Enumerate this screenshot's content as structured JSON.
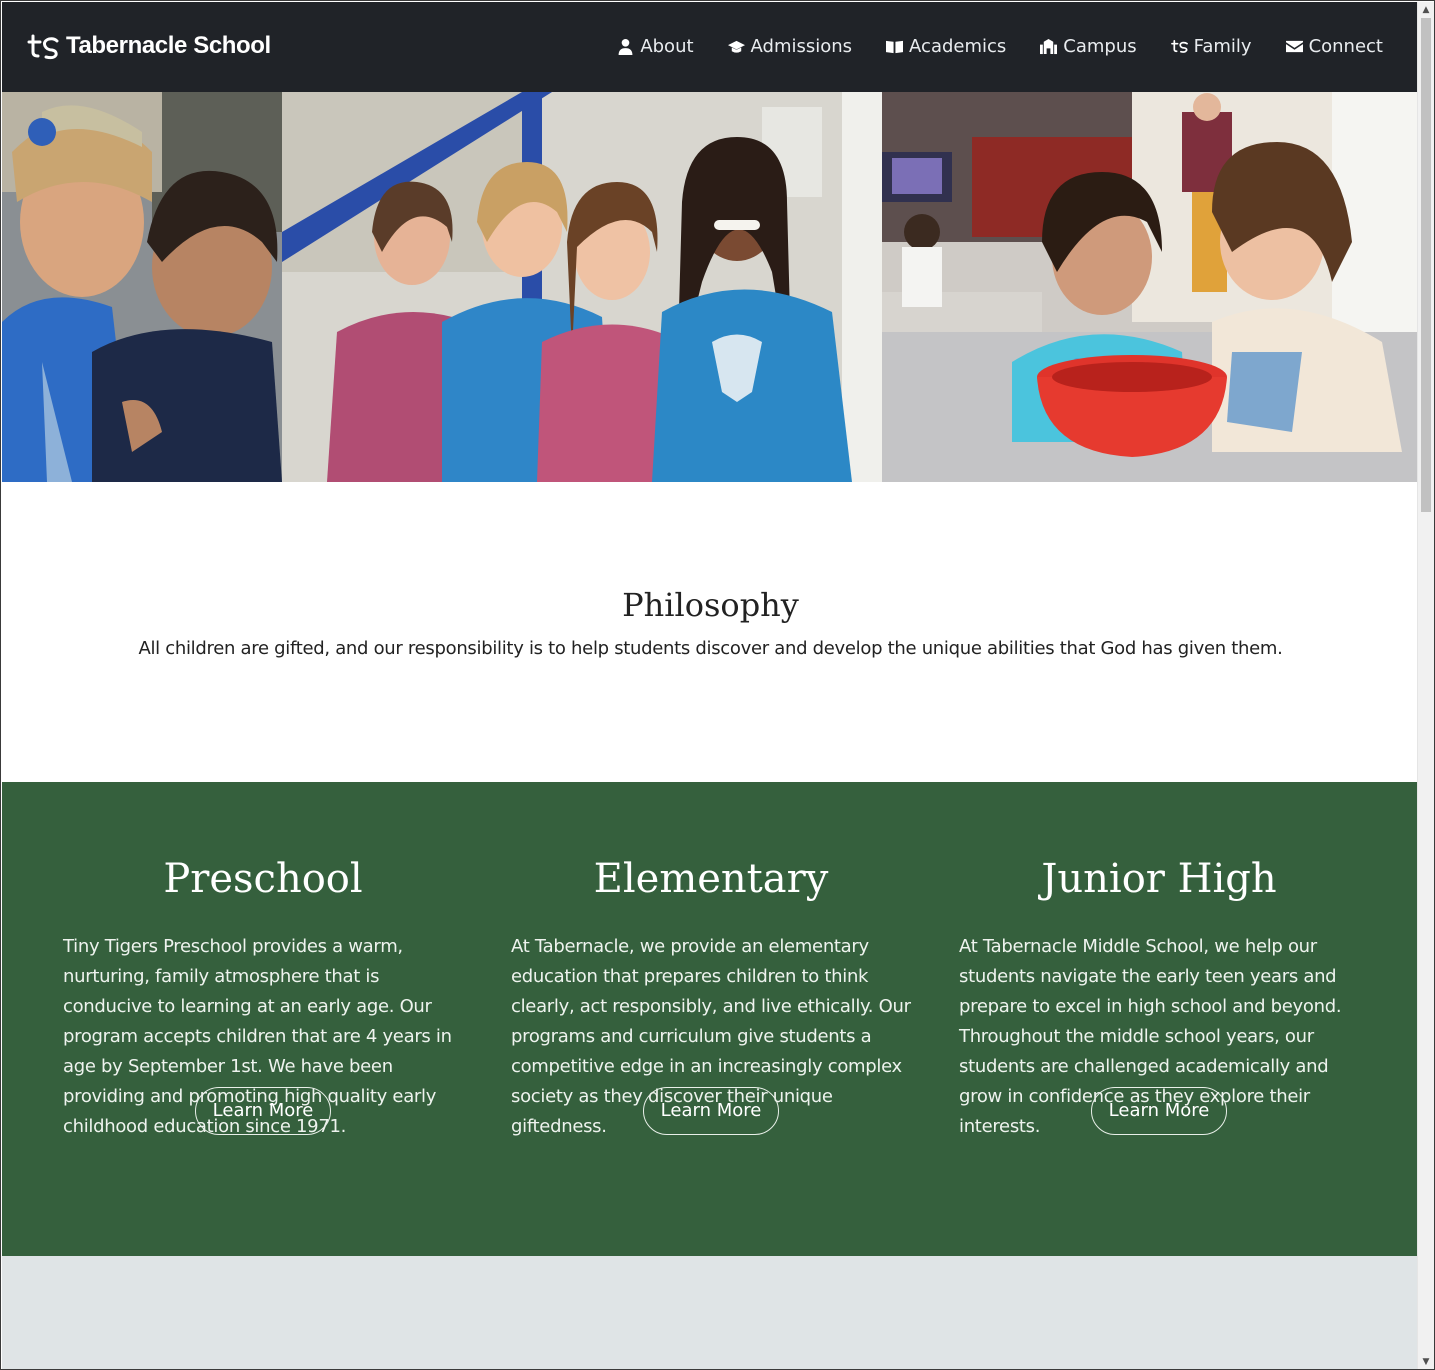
{
  "site": {
    "brand": "Tabernacle School"
  },
  "nav": {
    "items": [
      {
        "label": "About",
        "icon": "person-icon"
      },
      {
        "label": "Admissions",
        "icon": "graduation-cap-icon"
      },
      {
        "label": "Academics",
        "icon": "book-icon"
      },
      {
        "label": "Campus",
        "icon": "building-icon"
      },
      {
        "label": "Family",
        "icon": "ts-logo-icon"
      },
      {
        "label": "Connect",
        "icon": "envelope-icon"
      }
    ]
  },
  "hero": {
    "photos": [
      "students-photo-1",
      "students-photo-2",
      "preschool-photo-3"
    ]
  },
  "philosophy": {
    "title": "Philosophy",
    "text": "All children are gifted, and our responsibility is to help students discover and develop the unique abilities that God has given them."
  },
  "programs": [
    {
      "title": "Preschool",
      "text": "Tiny Tigers  Preschool provides a warm, nurturing, family atmosphere that is conducive to learning at an early age. Our program accepts children that are 4 years in age by September 1st. We have been providing and promoting high quality early childhood education since 1971.",
      "button": "Learn  More"
    },
    {
      "title": "Elementary",
      "text": "At Tabernacle, we provide an elementary education that prepares children to think clearly, act responsibly, and live ethically. Our programs and curriculum give students a competitive edge in an increasingly complex society as they discover their unique giftedness.",
      "button": "Learn  More"
    },
    {
      "title": "Junior High",
      "text": "At Tabernacle  Middle School, we help our students navigate the early teen years and prepare to excel in high school and beyond. Throughout the middle school years, our students are challenged academically and grow in confidence as they explore their interests.",
      "button": "Learn  More"
    }
  ],
  "colors": {
    "navbar": "#202328",
    "programs_bg": "#35603d",
    "bottom_bg": "#dfe4e6"
  }
}
